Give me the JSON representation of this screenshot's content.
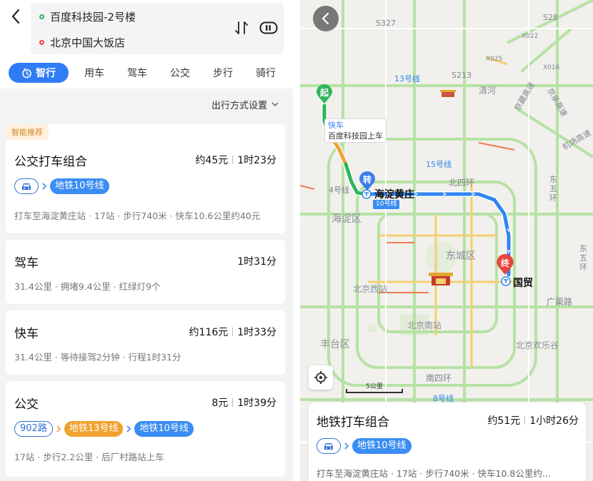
{
  "header": {
    "origin": "百度科技园-2号楼",
    "destination": "北京中国大饭店"
  },
  "modes": {
    "active": "智行",
    "items": [
      "用车",
      "驾车",
      "公交",
      "步行",
      "骑行"
    ]
  },
  "settings_label": "出行方式设置",
  "cards": [
    {
      "tag": "智能推荐",
      "title": "公交打车组合",
      "price": "约45元",
      "duration": "1时23分",
      "chips": [
        "地铁10号线"
      ],
      "detail": "打车至海淀黄庄站 · 17站 · 步行740米 · 快车10.6公里约40元"
    },
    {
      "title": "驾车",
      "duration": "1时31分",
      "detail": "31.4公里 · 拥堵9.4公里 · 红绿灯9个"
    },
    {
      "title": "快车",
      "price": "约116元",
      "duration": "1时33分",
      "detail": "31.4公里 · 等待接驾2分钟 · 行程1时31分"
    },
    {
      "title": "公交",
      "price": "8元",
      "duration": "1时39分",
      "chips": [
        "902路",
        "地铁13号线",
        "地铁10号线"
      ],
      "detail": "17站 · 步行2.2公里 · 后厂村路站上车"
    }
  ],
  "map": {
    "start_pin": "起",
    "transfer_pin": "转",
    "end_pin": "终",
    "callout_line1": "快车",
    "callout_line2": "百度科技园上车",
    "transfer_station": "海淀黄庄",
    "transfer_line": "10号线",
    "end_station": "国贸",
    "districts": [
      "清河",
      "海淀区",
      "东城区",
      "丰台区",
      "北京西站",
      "北京南站",
      "北京欢乐谷",
      "北四环",
      "广渠路",
      "南四环",
      "东五环",
      "东五环",
      "京承高速",
      "机场高速",
      "京藏高速"
    ],
    "road_tags": [
      "13号线",
      "S213",
      "15号线",
      "S327",
      "S28",
      "X022",
      "X025",
      "X016",
      "8号线",
      "4号线"
    ],
    "scale_label": "5公里",
    "bottom_card": {
      "title": "地铁打车组合",
      "price": "约51元",
      "duration": "1小时26分",
      "chips": [
        "地铁10号线"
      ],
      "detail": "打车至海淀黄庄站 · 17站 · 步行740米 · 快车10.8公里约..."
    }
  },
  "colors": {
    "accent": "#2f7cf5",
    "subway_line": "#3a8df2",
    "line13": "#f0a230",
    "recommend_bg": "#fff1dc",
    "recommend_text": "#d08a2c",
    "route_start": "#2fb65a",
    "route_end": "#e8453c"
  }
}
